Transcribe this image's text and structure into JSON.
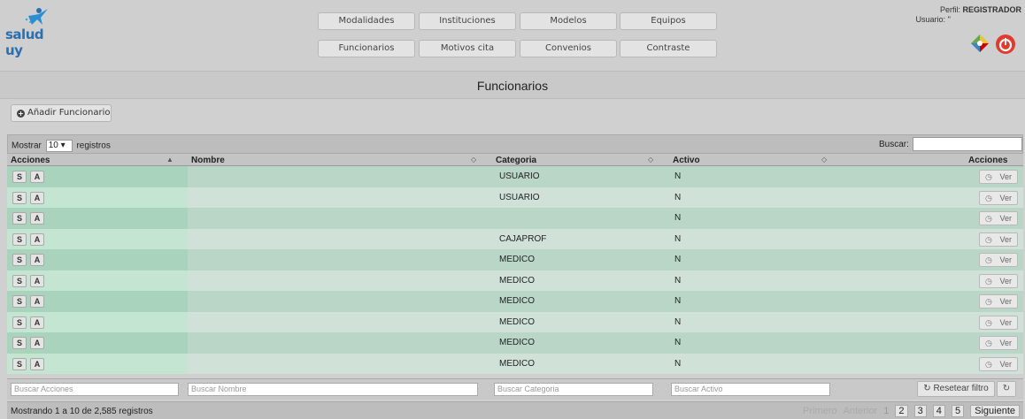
{
  "logo": {
    "text": "salud uy"
  },
  "nav": {
    "row1": [
      "Modalidades",
      "Instituciones",
      "Modelos",
      "Equipos"
    ],
    "row2": [
      "Funcionarios",
      "Motivos cita",
      "Convenios",
      "Contraste"
    ]
  },
  "profile": {
    "perfil_label": "Perfil:",
    "perfil_value": "REGISTRADOR",
    "usuario_label": "Usuario:",
    "usuario_value": "''"
  },
  "page": {
    "title": "Funcionarios",
    "add_button": "Añadir Funcionario"
  },
  "toolbar": {
    "show_prefix": "Mostrar",
    "show_value": "10",
    "show_suffix": "registros",
    "search_label": "Buscar:"
  },
  "table": {
    "headers": [
      "Acciones",
      "Nombre",
      "Categoria",
      "Activo",
      "Acciones"
    ],
    "rows": [
      {
        "categoria": "USUARIO",
        "activo": "N"
      },
      {
        "categoria": "USUARIO",
        "activo": "N"
      },
      {
        "categoria": "",
        "activo": "N"
      },
      {
        "categoria": "CAJAPROF",
        "activo": "N"
      },
      {
        "categoria": "MEDICO",
        "activo": "N"
      },
      {
        "categoria": "MEDICO",
        "activo": "N"
      },
      {
        "categoria": "MEDICO",
        "activo": "N"
      },
      {
        "categoria": "MEDICO",
        "activo": "N"
      },
      {
        "categoria": "MEDICO",
        "activo": "N"
      },
      {
        "categoria": "MEDICO",
        "activo": "N"
      }
    ],
    "btn_s": "S",
    "btn_a": "A",
    "btn_ver": "Ver"
  },
  "filters": {
    "acciones": "Buscar Acciones",
    "nombre": "Buscar Nombre",
    "categoria": "Buscar Categoria",
    "activo": "Buscar Activo",
    "reset": "Resetear filtro"
  },
  "status": {
    "text": "Mostrando 1 a 10 de 2,585 registros"
  },
  "pager": {
    "first": "Primero",
    "prev": "Anterior",
    "pages": [
      "1",
      "2",
      "3",
      "4",
      "5"
    ],
    "next": "Siguiente"
  }
}
